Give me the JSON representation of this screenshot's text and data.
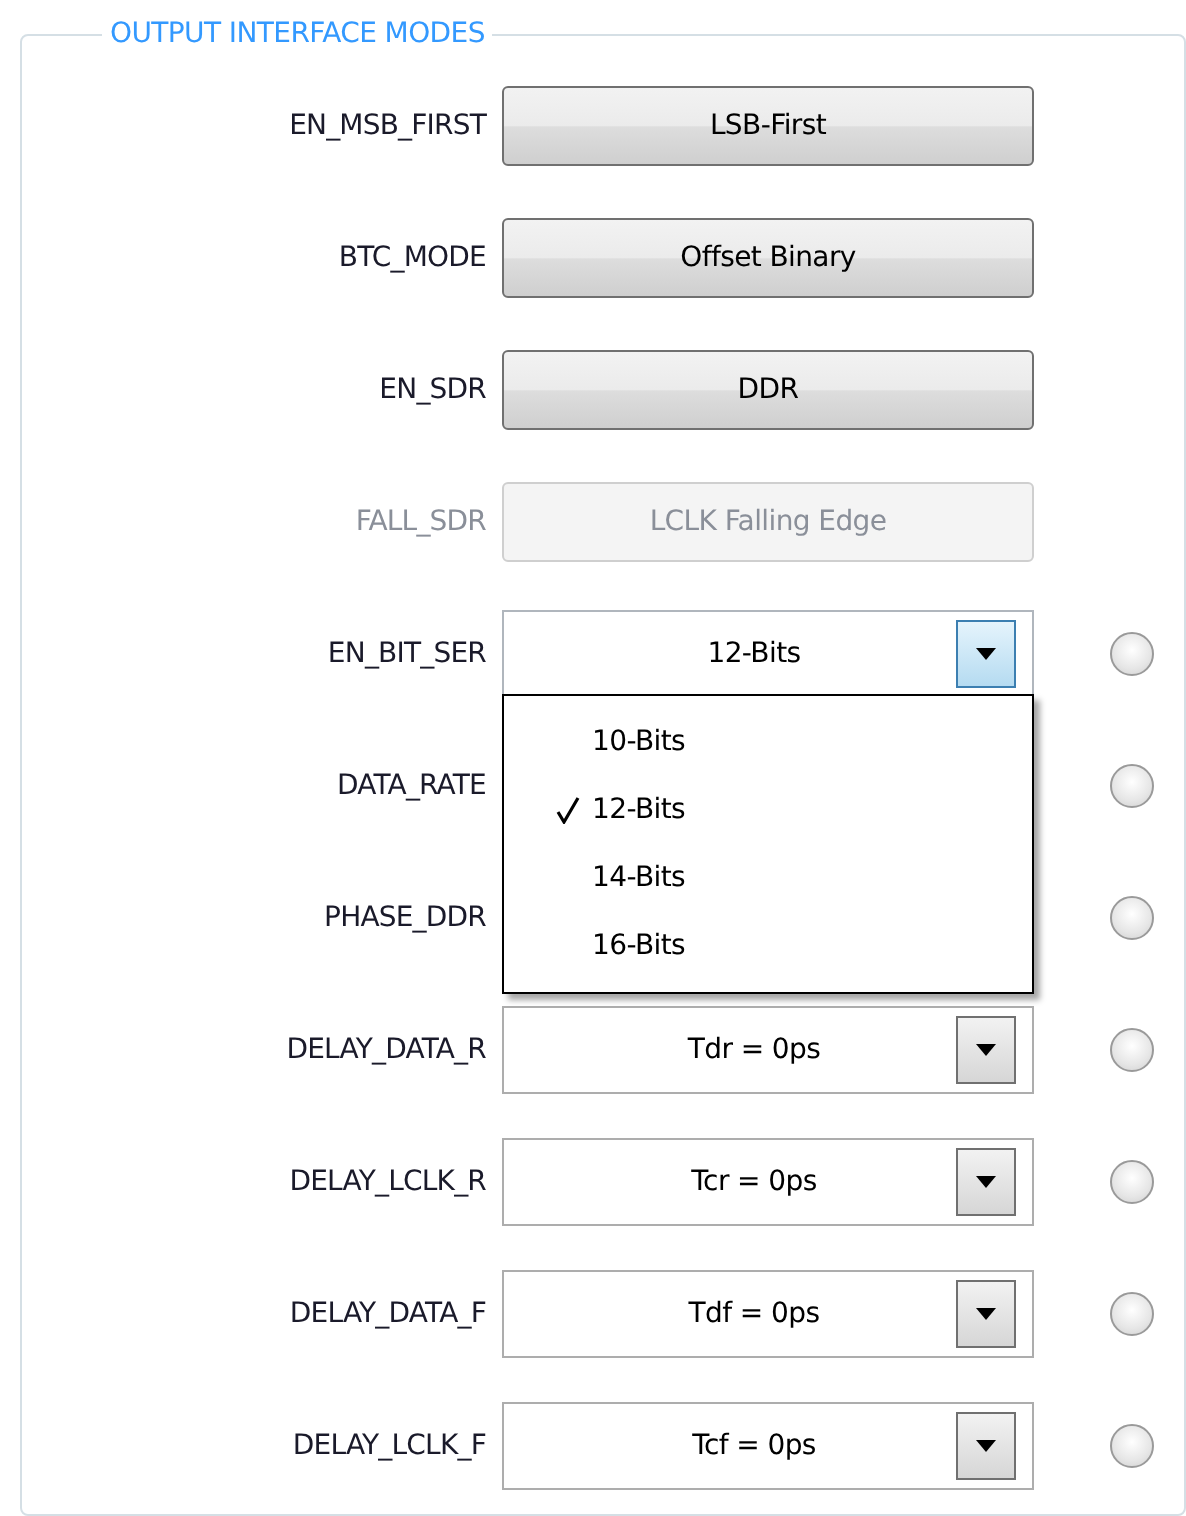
{
  "group": {
    "title": "OUTPUT INTERFACE MODES"
  },
  "rows": [
    {
      "kind": "button",
      "label": "EN_MSB_FIRST",
      "value": "LSB-First",
      "disabled": false
    },
    {
      "kind": "button",
      "label": "BTC_MODE",
      "value": "Offset Binary",
      "disabled": false
    },
    {
      "kind": "button",
      "label": "EN_SDR",
      "value": "DDR",
      "disabled": false
    },
    {
      "kind": "button",
      "label": "FALL_SDR",
      "value": "LCLK Falling Edge",
      "disabled": true
    },
    {
      "kind": "combo",
      "label": "EN_BIT_SER",
      "value": "12-Bits",
      "expanded": true,
      "radio": {
        "selected": false
      },
      "options": [
        {
          "label": "10-Bits",
          "selected": false
        },
        {
          "label": "12-Bits",
          "selected": true
        },
        {
          "label": "14-Bits",
          "selected": false
        },
        {
          "label": "16-Bits",
          "selected": false
        }
      ]
    },
    {
      "kind": "covered",
      "label": "DATA_RATE",
      "radio": {
        "selected": false
      }
    },
    {
      "kind": "covered",
      "label": "PHASE_DDR",
      "radio": {
        "selected": false
      }
    },
    {
      "kind": "combo",
      "label": "DELAY_DATA_R",
      "value": "Tdr = 0ps",
      "expanded": false,
      "radio": {
        "selected": false
      }
    },
    {
      "kind": "combo",
      "label": "DELAY_LCLK_R",
      "value": "Tcr = 0ps",
      "expanded": false,
      "radio": {
        "selected": false
      }
    },
    {
      "kind": "combo",
      "label": "DELAY_DATA_F",
      "value": "Tdf = 0ps",
      "expanded": false,
      "radio": {
        "selected": false
      }
    },
    {
      "kind": "combo",
      "label": "DELAY_LCLK_F",
      "value": "Tcf = 0ps",
      "expanded": false,
      "radio": {
        "selected": false
      }
    }
  ]
}
